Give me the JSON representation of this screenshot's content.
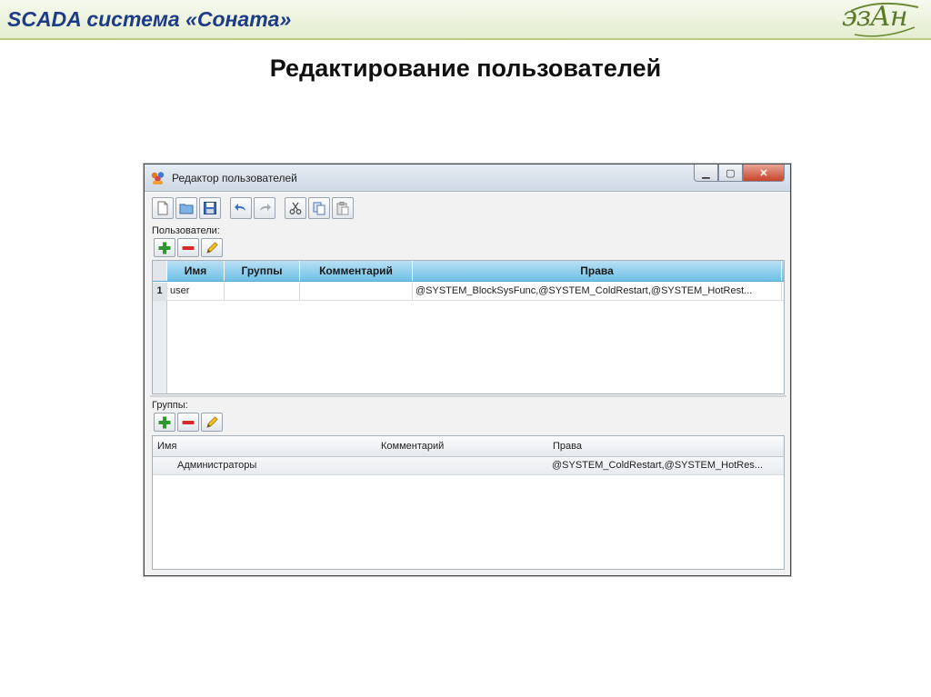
{
  "slide": {
    "title": "SCADA система «Соната»",
    "logo_text": "эзАн",
    "heading": "Редактирование пользователей"
  },
  "window": {
    "title": "Редактор пользователей",
    "min_label": "▁",
    "max_label": "▢",
    "close_label": "✕"
  },
  "toolbar": {
    "buttons": [
      "new-file-icon",
      "open-folder-icon",
      "save-icon",
      "undo-icon",
      "redo-icon",
      "cut-icon",
      "copy-icon",
      "paste-icon"
    ]
  },
  "users": {
    "label": "Пользователи:",
    "columns": [
      "Имя",
      "Группы",
      "Комментарий",
      "Права"
    ],
    "rows": [
      {
        "num": "1",
        "name": "user",
        "groups": "",
        "comment": "",
        "rights": "@SYSTEM_BlockSysFunc,@SYSTEM_ColdRestart,@SYSTEM_HotRest..."
      }
    ]
  },
  "groups": {
    "label": "Группы:",
    "columns": [
      "Имя",
      "Комментарий",
      "Права"
    ],
    "rows": [
      {
        "name": "Администраторы",
        "comment": "",
        "rights": "@SYSTEM_ColdRestart,@SYSTEM_HotRes..."
      }
    ]
  },
  "colors": {
    "slide_title": "#1d3b87",
    "grid_header": "#8fcdec",
    "add": "#2e9a2e",
    "remove": "#d42b2b",
    "edit": "#e6a900"
  }
}
